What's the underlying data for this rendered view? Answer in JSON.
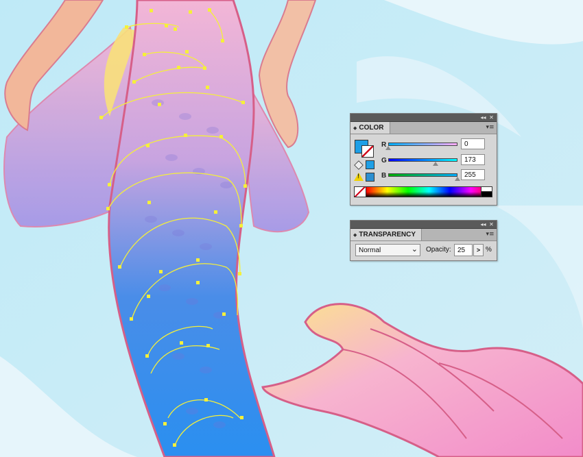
{
  "color_panel": {
    "title": "COLOR",
    "fill_color": "#1f9fe6",
    "warning_swatch": "#2c8fd1",
    "cube_swatch": "#1f9fe6",
    "channels": [
      {
        "label": "R",
        "value": "0",
        "level": 0
      },
      {
        "label": "G",
        "value": "173",
        "level": 0.68
      },
      {
        "label": "B",
        "value": "255",
        "level": 1.0
      }
    ]
  },
  "transparency_panel": {
    "title": "TRANSPARENCY",
    "blend_mode": "Normal",
    "opacity_label": "Opacity:",
    "opacity_value": "25",
    "percent": "%"
  },
  "icons": {
    "collapse": "double-left-arrow-icon",
    "close": "close-icon",
    "menu": "panel-menu-icon",
    "warning": "out-of-gamut-warning-icon",
    "cube": "web-safe-cube-icon"
  },
  "glyphs": {
    "collapse": "◂◂",
    "close": "✕",
    "menu": "▾≡",
    "tab_arrows": "◆",
    "dropdown": "⌄",
    "stepper": ">",
    "warning": "!"
  }
}
